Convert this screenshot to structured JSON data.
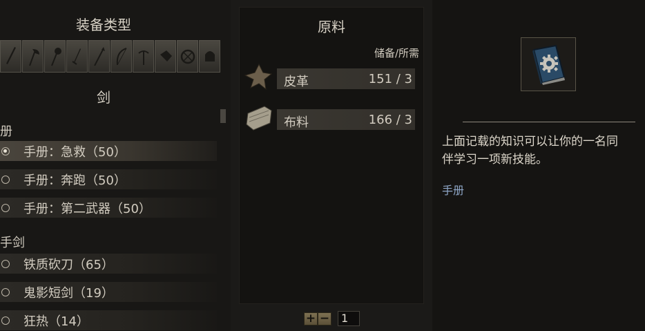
{
  "left": {
    "title": "装备类型",
    "categories": [
      {
        "icon": "sword-icon"
      },
      {
        "icon": "axe-icon"
      },
      {
        "icon": "mace-icon"
      },
      {
        "icon": "dagger-icon"
      },
      {
        "icon": "spear-icon"
      },
      {
        "icon": "bow-icon"
      },
      {
        "icon": "crossbow-icon"
      },
      {
        "icon": "throwing-icon"
      },
      {
        "icon": "shield-icon"
      },
      {
        "icon": "helmet-icon"
      }
    ],
    "subtitle": "剑",
    "groups": [
      {
        "label": "册"
      },
      {
        "label": "手剑"
      }
    ],
    "items": [
      {
        "label": "手册：急救（50）",
        "selected": true
      },
      {
        "label": "手册：奔跑（50）",
        "selected": false
      },
      {
        "label": "手册：第二武器（50）",
        "selected": false
      },
      {
        "label": "铁质砍刀（65）",
        "selected": false
      },
      {
        "label": "鬼影短剑（19）",
        "selected": false
      },
      {
        "label": "狂热（14）",
        "selected": false
      }
    ]
  },
  "materials": {
    "title": "原料",
    "header": "储备/所需",
    "rows": [
      {
        "name": "皮革",
        "count": "151 / 3",
        "icon": "leather-icon"
      },
      {
        "name": "布料",
        "count": "166 / 3",
        "icon": "cloth-icon"
      }
    ],
    "quantity": "1"
  },
  "detail": {
    "icon": "manual-book-icon",
    "desc_line1": "上面记载的知识可以让你的一名同",
    "desc_line2": "伴学习一项新技能。",
    "type": "手册",
    "type_color": "#8fa7c8"
  }
}
